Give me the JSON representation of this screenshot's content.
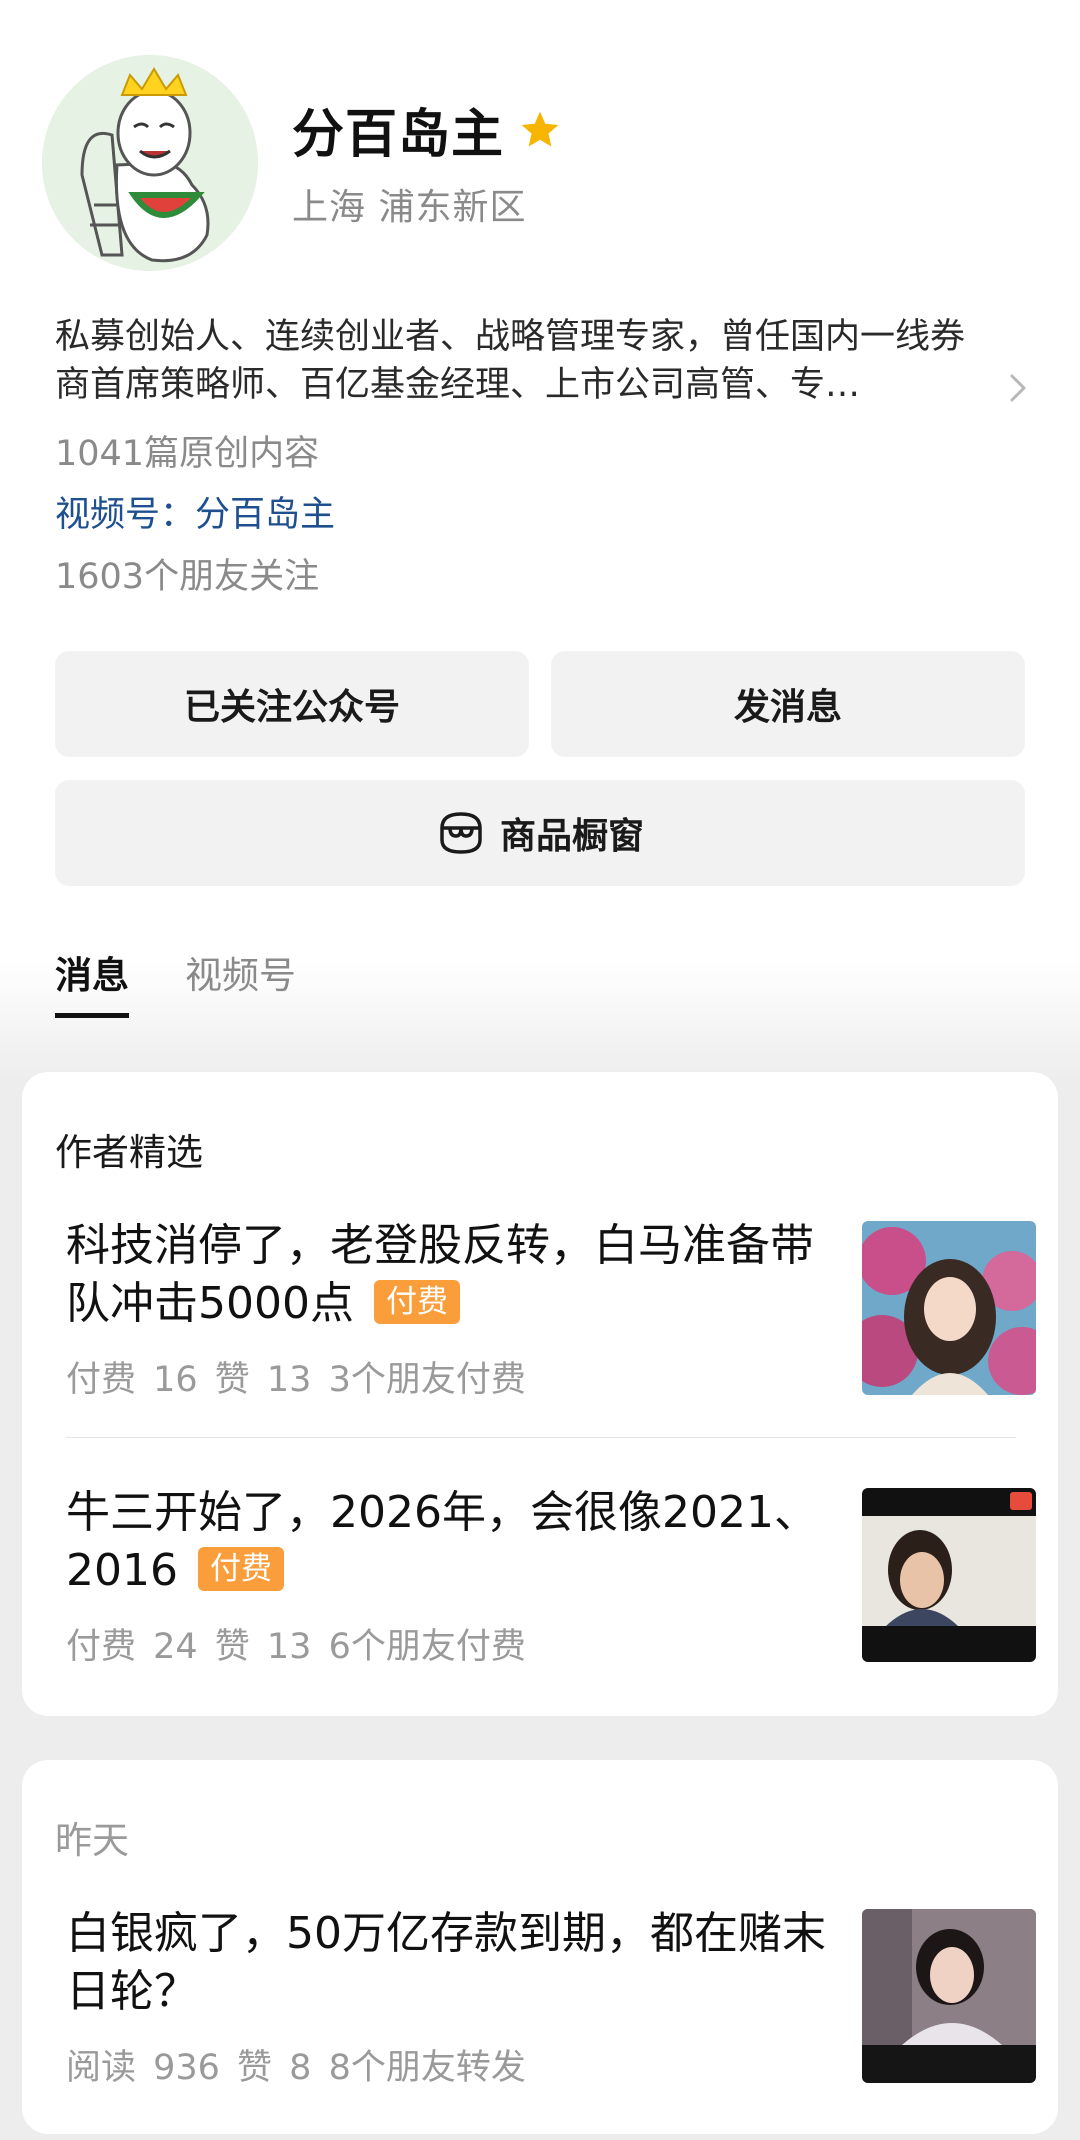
{
  "profile": {
    "name": "分百岛主",
    "location": "上海 浦东新区",
    "bio": "私募创始人、连续创业者、战略管理专家，曾任国内一线券商首席策略师、百亿基金经理、上市公司高管、专…",
    "original_count": "1041篇原创内容",
    "channel_label": "视频号：",
    "channel_name": "分百岛主",
    "followers": "1603个朋友关注",
    "verified_color": "#f7b500"
  },
  "buttons": {
    "follow": "已关注公众号",
    "message": "发消息",
    "shop": "商品橱窗"
  },
  "tabs": [
    {
      "label": "消息",
      "active": true
    },
    {
      "label": "视频号",
      "active": false
    }
  ],
  "featured": {
    "title": "作者精选",
    "articles": [
      {
        "title": "科技消停了，老登股反转，白马准备带队冲击5000点",
        "tag": "付费",
        "meta": "付费 16  赞 13  3个朋友付费"
      },
      {
        "title": "牛三开始了，2026年，会很像2021、2016",
        "tag": "付费",
        "meta": "付费 24  赞 13  6个朋友付费"
      }
    ]
  },
  "recent": {
    "title": "昨天",
    "articles": [
      {
        "title": "白银疯了，50万亿存款到期，都在赌末日轮？",
        "meta": "阅读 936  赞 8  8个朋友转发"
      }
    ]
  },
  "colors": {
    "paid_tag": "#fa9d3b",
    "link": "#1e4f8f"
  }
}
